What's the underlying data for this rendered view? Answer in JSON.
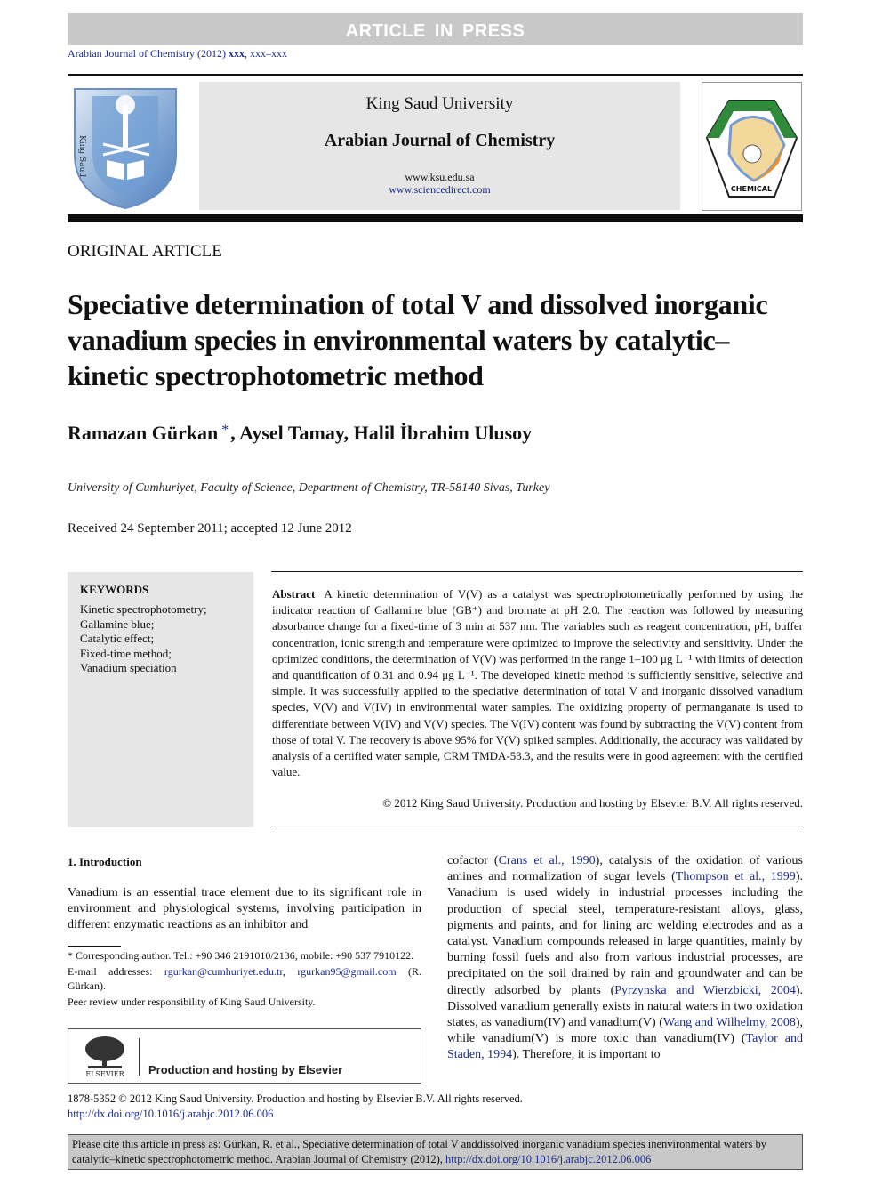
{
  "banner": {
    "text": "ARTICLE IN PRESS"
  },
  "journal_ref": {
    "prefix": "Arabian Journal of Chemistry (2012) ",
    "volume": "xxx",
    "pages": ", xxx–xxx"
  },
  "header": {
    "university": "King Saud University",
    "journal": "Arabian Journal of Chemistry",
    "url1": "www.ksu.edu.sa",
    "url2": "www.sciencedirect.com",
    "left_logo": "King Saud University 1957",
    "right_logo": "CHEMICAL"
  },
  "article": {
    "type": "ORIGINAL ARTICLE",
    "title": "Speciative determination of total V and dissolved inorganic vanadium species in environmental waters by catalytic–kinetic spectrophotometric method",
    "authors": {
      "a1": "Ramazan Gürkan",
      "star": "*",
      "rest": ", Aysel Tamay, Halil İbrahim Ulusoy"
    },
    "affiliation": "University of Cumhuriyet, Faculty of Science, Department of Chemistry, TR-58140 Sivas, Turkey",
    "received": "Received 24 September 2011; accepted 12 June 2012"
  },
  "keywords": {
    "heading": "KEYWORDS",
    "items": [
      "Kinetic spectrophotometry;",
      "Gallamine blue;",
      "Catalytic effect;",
      "Fixed-time method;",
      "Vanadium speciation"
    ]
  },
  "abstract": {
    "label": "Abstract",
    "text": "A kinetic determination of V(V) as a catalyst was spectrophotometrically performed by using the indicator reaction of Gallamine blue (GB⁺) and bromate at pH 2.0. The reaction was followed by measuring absorbance change for a fixed-time of 3 min at 537 nm. The variables such as reagent concentration, pH, buffer concentration, ionic strength and temperature were optimized to improve the selectivity and sensitivity. Under the optimized conditions, the determination of V(V) was performed in the range 1–100 μg L⁻¹ with limits of detection and quantification of 0.31 and 0.94 μg L⁻¹. The developed kinetic method is sufficiently sensitive, selective and simple. It was successfully applied to the speciative determination of total V and inorganic dissolved vanadium species, V(V) and V(IV) in environmental water samples. The oxidizing property of permanganate is used to differentiate between V(IV) and V(V) species. The V(IV) content was found by subtracting the V(V) content from those of total V. The recovery is above 95% for V(V) spiked samples. Additionally, the accuracy was validated by analysis of a certified water sample, CRM TMDA-53.3, and the results were in good agreement with the certified value.",
    "copyright": "© 2012 King Saud University. Production and hosting by Elsevier B.V. All rights reserved."
  },
  "introduction": {
    "heading": "1. Introduction",
    "col1": "Vanadium is an essential trace element due to its significant role in environment and physiological systems, involving participation in different enzymatic reactions as an inhibitor and",
    "col2": {
      "p1": "cofactor (",
      "ref1": "Crans et al., 1990",
      "p2": "), catalysis of the oxidation of various amines and normalization of sugar levels (",
      "ref2": "Thompson et al., 1999",
      "p3": "). Vanadium is used widely in industrial processes including the production of special steel, temperature-resistant alloys, glass, pigments and paints, and for lining arc welding electrodes and as a catalyst. Vanadium compounds released in large quantities, mainly by burning fossil fuels and also from various industrial processes, are precipitated on the soil drained by rain and groundwater and can be directly adsorbed by plants (",
      "ref3": "Pyrzynska and Wierzbicki, 2004",
      "p4": "). Dissolved vanadium generally exists in natural waters in two oxidation states, as vanadium(IV) and vanadium(V) (",
      "ref4": "Wang and Wilhelmy, 2008",
      "p5": "), while vanadium(V) is more toxic than vanadium(IV) (",
      "ref5": "Taylor and Staden, 1994",
      "p6": "). Therefore, it is important to"
    }
  },
  "footnotes": {
    "corresponding": "* Corresponding author. Tel.: +90 346 2191010/2136, mobile: +90 537 7910122.",
    "email_label": "E-mail addresses: ",
    "email1": "rgurkan@cumhuriyet.edu.tr",
    "email_sep": ", ",
    "email2": "rgurkan95@gmail.com",
    "email_suffix": " (R. Gürkan).",
    "peer_review": "Peer review under responsibility of King Saud University."
  },
  "elsevier": {
    "logo_text": "ELSEVIER",
    "text": "Production and hosting by Elsevier"
  },
  "footer": {
    "issn": "1878-5352 © 2012 King Saud University. Production and hosting by Elsevier B.V. All rights reserved.",
    "doi": "http://dx.doi.org/10.1016/j.arabjc.2012.06.006",
    "cite_text": "Please cite this article in press as: Gürkan, R. et al., Speciative determination of total V anddissolved inorganic vanadium species inenvironmental waters  by catalytic–kinetic spectrophotometric method. Arabian Journal of Chemistry (2012), ",
    "cite_doi": "http://dx.doi.org/10.1016/j.arabjc.2012.06.006"
  }
}
